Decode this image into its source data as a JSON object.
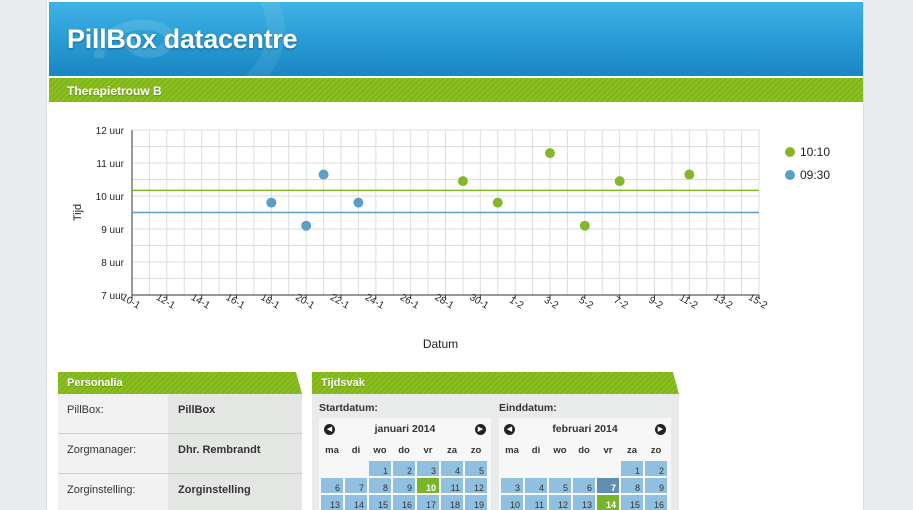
{
  "app": {
    "title": "PillBox datacentre"
  },
  "section": {
    "title": "Therapietrouw B"
  },
  "chart_data": {
    "type": "scatter",
    "ylabel": "Tijd",
    "xlabel": "Datum",
    "y_ticks": [
      "7 uur",
      "8 uur",
      "9 uur",
      "10 uur",
      "11 uur",
      "12 uur"
    ],
    "ylim": [
      7,
      12
    ],
    "x_ticks": [
      "10-1",
      "12-1",
      "14-1",
      "16-1",
      "18-1",
      "20-1",
      "22-1",
      "24-1",
      "26-1",
      "28-1",
      "30-1",
      "1-2",
      "3-2",
      "5-2",
      "7-2",
      "9-2",
      "11-2",
      "13-2",
      "15-2"
    ],
    "grid": true,
    "legend": "right",
    "series": [
      {
        "name": "10:10",
        "color": "#84b82c",
        "target": 10.17,
        "points": [
          {
            "x": "29-1",
            "y": 10.45
          },
          {
            "x": "31-1",
            "y": 9.8
          },
          {
            "x": "3-2",
            "y": 11.3
          },
          {
            "x": "5-2",
            "y": 9.1
          },
          {
            "x": "7-2",
            "y": 10.45
          },
          {
            "x": "11-2",
            "y": 10.65
          }
        ]
      },
      {
        "name": "09:30",
        "color": "#5b9ec6",
        "target": 9.5,
        "points": [
          {
            "x": "18-1",
            "y": 9.8
          },
          {
            "x": "20-1",
            "y": 9.1
          },
          {
            "x": "21-1",
            "y": 10.65
          },
          {
            "x": "23-1",
            "y": 9.8
          }
        ]
      }
    ]
  },
  "personalia": {
    "title": "Personalia",
    "rows": [
      {
        "label": "PillBox:",
        "value": "PillBox"
      },
      {
        "label": "Zorgmanager:",
        "value": "Dhr. Rembrandt"
      },
      {
        "label": "Zorginstelling:",
        "value": "Zorginstelling"
      }
    ]
  },
  "tijdsvak": {
    "title": "Tijdsvak",
    "start_label": "Startdatum:",
    "end_label": "Einddatum:",
    "weekdays": [
      "ma",
      "di",
      "wo",
      "do",
      "vr",
      "za",
      "zo"
    ],
    "start_calendar": {
      "month": "januari 2014",
      "offset": 2,
      "days": [
        "1",
        "2",
        "3",
        "4",
        "5",
        "6",
        "7",
        "8",
        "9",
        "10",
        "11",
        "12",
        "13",
        "14",
        "15",
        "16",
        "17",
        "18",
        "19"
      ],
      "selected": "10"
    },
    "end_calendar": {
      "month": "februari 2014",
      "offset": 5,
      "days": [
        "1",
        "2",
        "3",
        "4",
        "5",
        "6",
        "7",
        "8",
        "9",
        "10",
        "11",
        "12",
        "13",
        "14",
        "15",
        "16"
      ],
      "selected": "14",
      "today": "7"
    }
  }
}
